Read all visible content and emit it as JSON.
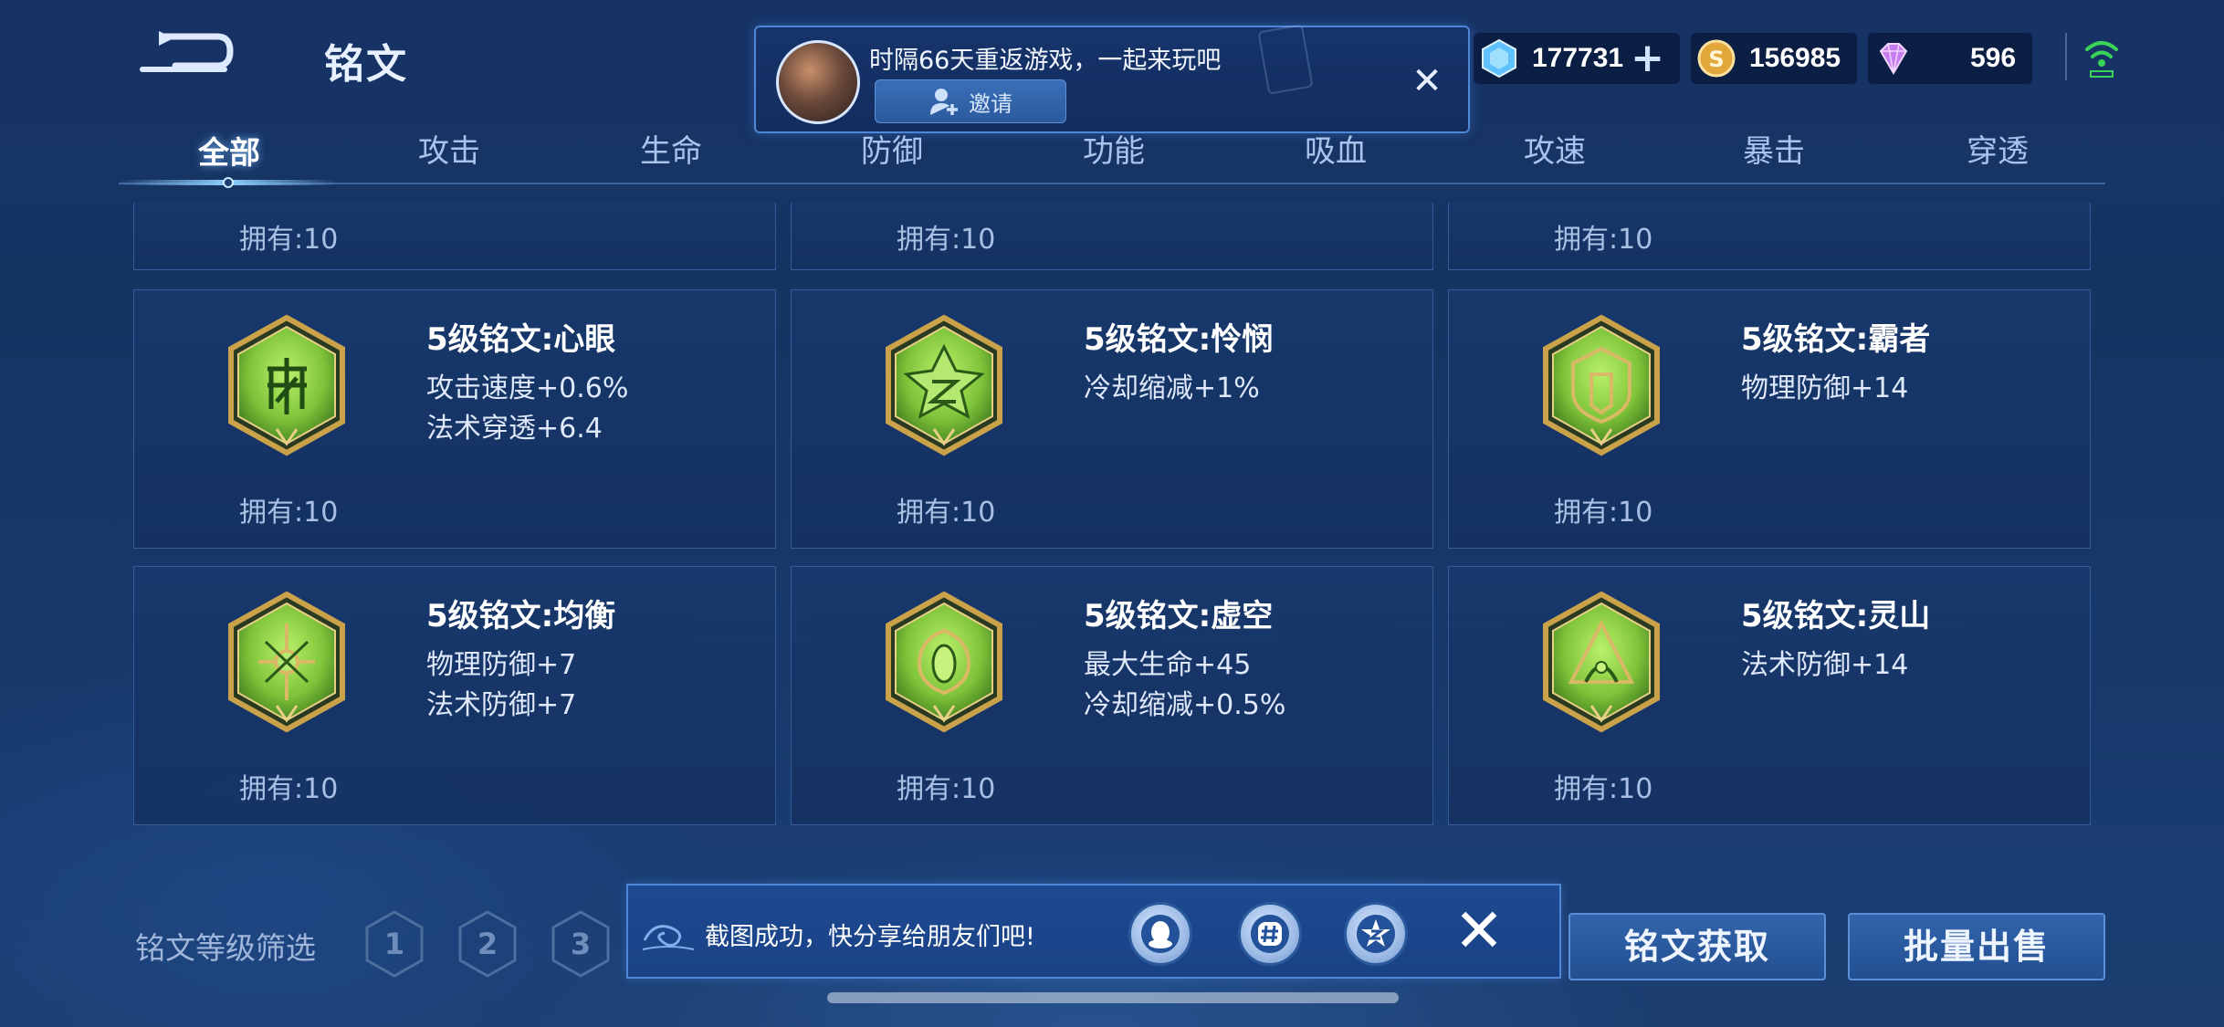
{
  "header": {
    "title": "铭文",
    "currencies": [
      {
        "icon": "diamond-icon",
        "value": "177731"
      },
      {
        "icon": "gold-coin-icon",
        "value": "156985"
      },
      {
        "icon": "gem-icon",
        "value": "596"
      }
    ]
  },
  "notification": {
    "message": "时隔66天重返游戏，一起来玩吧",
    "invite_label": "邀请",
    "close_label": "✕"
  },
  "tabs": [
    "全部",
    "攻击",
    "生命",
    "防御",
    "功能",
    "吸血",
    "攻速",
    "暴击",
    "穿透"
  ],
  "active_tab": 0,
  "cards": [
    {
      "owned": "拥有:10"
    },
    {
      "owned": "拥有:10"
    },
    {
      "owned": "拥有:10"
    },
    {
      "name": "5级铭文:心眼",
      "attrs": [
        "攻击速度+0.6%",
        "法术穿透+6.4"
      ],
      "owned": "拥有:10",
      "symbol": "eye"
    },
    {
      "name": "5级铭文:怜悯",
      "attrs": [
        "冷却缩减+1%"
      ],
      "owned": "拥有:10",
      "symbol": "star"
    },
    {
      "name": "5级铭文:霸者",
      "attrs": [
        "物理防御+14"
      ],
      "owned": "拥有:10",
      "symbol": "shield"
    },
    {
      "name": "5级铭文:均衡",
      "attrs": [
        "物理防御+7",
        "法术防御+7"
      ],
      "owned": "拥有:10",
      "symbol": "cross"
    },
    {
      "name": "5级铭文:虚空",
      "attrs": [
        "最大生命+45",
        "冷却缩减+0.5%"
      ],
      "owned": "拥有:10",
      "symbol": "void"
    },
    {
      "name": "5级铭文:灵山",
      "attrs": [
        "法术防御+14"
      ],
      "owned": "拥有:10",
      "symbol": "mountain"
    }
  ],
  "footer": {
    "filter_label": "铭文等级筛选",
    "levels": [
      "1",
      "2",
      "3"
    ],
    "share_text": "截图成功，快分享给朋友们吧!",
    "get_button": "铭文获取",
    "sell_button": "批量出售"
  },
  "colors": {
    "background": "#173366",
    "accent": "#4f86d6",
    "emblem_green": "#7fc43a",
    "emblem_gold": "#c9a24a"
  }
}
